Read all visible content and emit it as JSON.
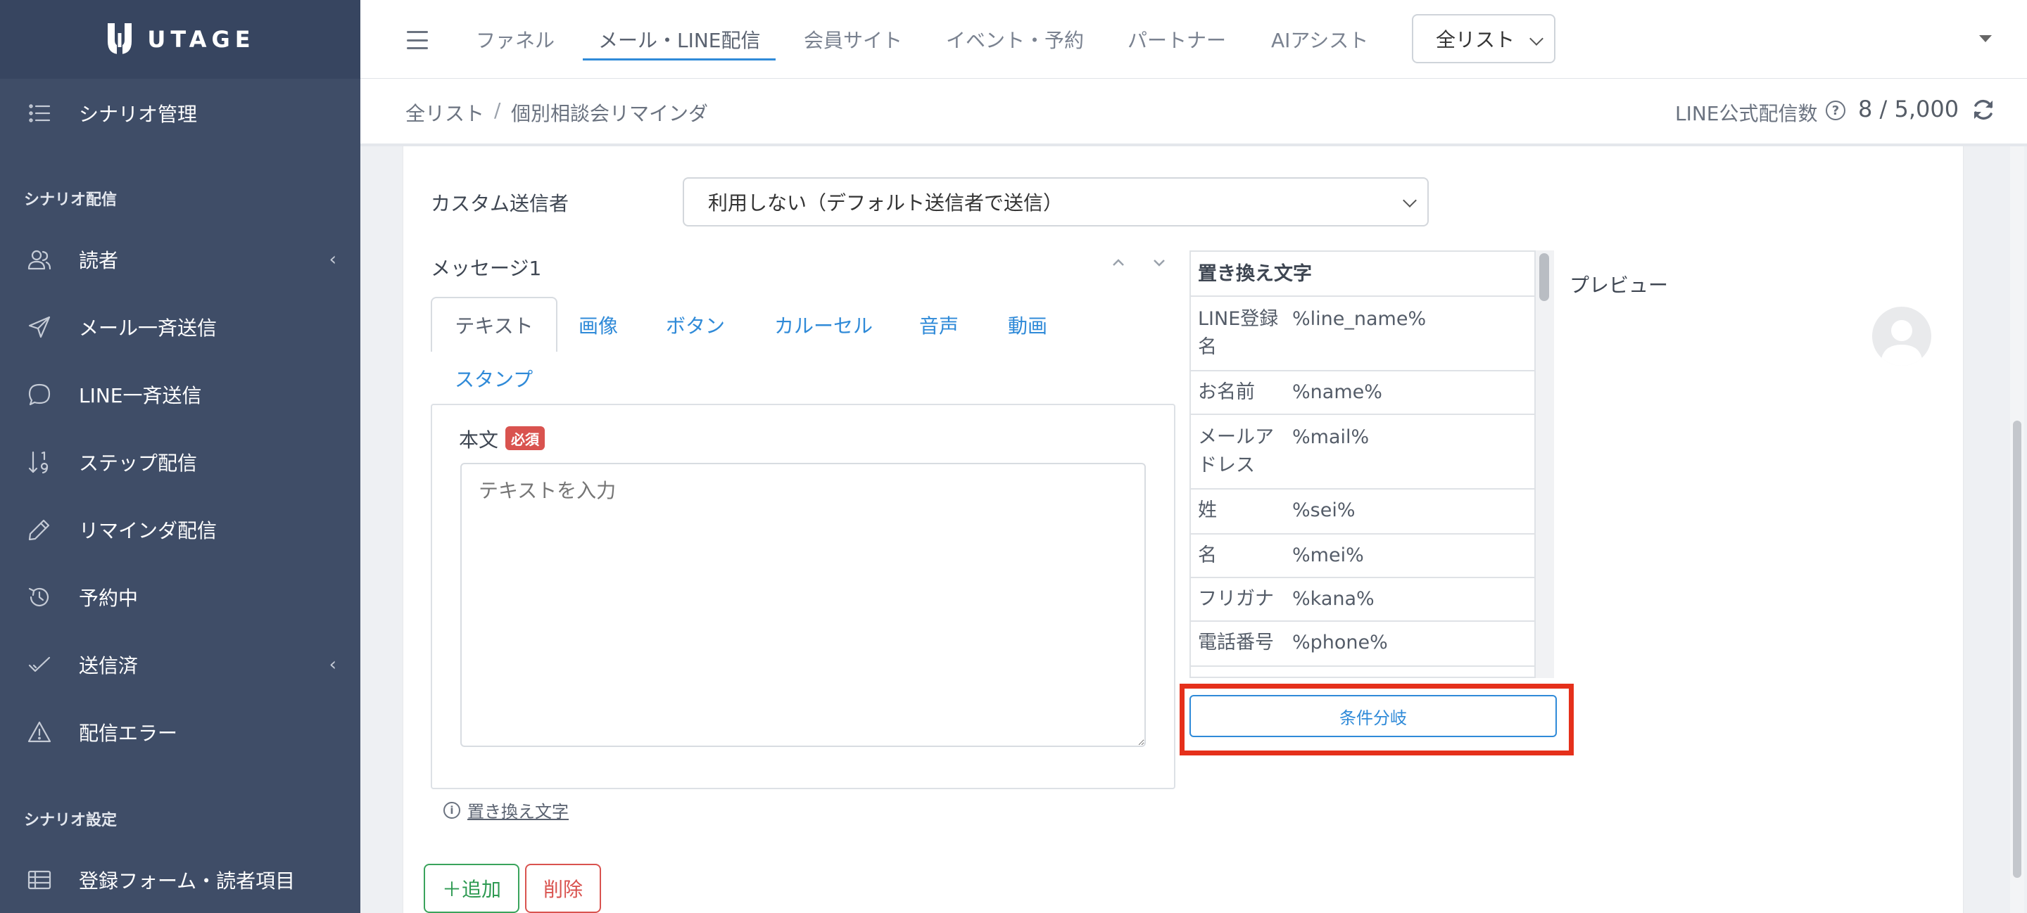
{
  "brand": {
    "name": "UTAGE"
  },
  "sidebar": {
    "items": [
      {
        "label": "シナリオ管理",
        "icon": "list-icon"
      },
      {
        "heading": "シナリオ配信"
      },
      {
        "label": "読者",
        "icon": "users-icon",
        "has_chevron": true
      },
      {
        "label": "メール一斉送信",
        "icon": "send-icon"
      },
      {
        "label": "LINE一斉送信",
        "icon": "chat-bubble-icon"
      },
      {
        "label": "ステップ配信",
        "icon": "sort-numeric-icon"
      },
      {
        "label": "リマインダ配信",
        "icon": "pencil-icon"
      },
      {
        "label": "予約中",
        "icon": "history-icon"
      },
      {
        "label": "送信済",
        "icon": "check-icon",
        "has_chevron": true
      },
      {
        "label": "配信エラー",
        "icon": "warning-icon"
      },
      {
        "heading": "シナリオ設定"
      },
      {
        "label": "登録フォーム・読者項目",
        "icon": "table-icon"
      }
    ],
    "chevron": "‹"
  },
  "topnav": {
    "tabs": [
      {
        "label": "ファネル"
      },
      {
        "label": "メール・LINE配信",
        "active": true
      },
      {
        "label": "会員サイト"
      },
      {
        "label": "イベント・予約"
      },
      {
        "label": "パートナー"
      },
      {
        "label": "AIアシスト"
      }
    ],
    "list_select": "全リスト"
  },
  "breadcrumb": {
    "items": [
      "全リスト",
      "個別相談会リマインダ"
    ],
    "separator": "/"
  },
  "quota": {
    "label": "LINE公式配信数",
    "value": "8 / 5,000"
  },
  "form": {
    "custom_sender_label": "カスタム送信者",
    "custom_sender_value": "利用しない（デフォルト送信者で送信）",
    "message_title": "メッセージ1",
    "message_tabs": [
      "テキスト",
      "画像",
      "ボタン",
      "カルーセル",
      "音声",
      "動画",
      "スタンプ"
    ],
    "active_tab": "テキスト",
    "body_label": "本文",
    "required_badge": "必須",
    "textarea_placeholder": "テキストを入力",
    "replacement_link": "置き換え文字",
    "add_button": "＋追加",
    "delete_button": "削除"
  },
  "replacement_table": {
    "header": "置き換え文字",
    "rows": [
      {
        "key": "LINE登録\n名",
        "value": "%line_name%"
      },
      {
        "key": "お名前",
        "value": "%name%"
      },
      {
        "key": "メールア\nドレス",
        "value": "%mail%"
      },
      {
        "key": "姓",
        "value": "%sei%"
      },
      {
        "key": "名",
        "value": "%mei%"
      },
      {
        "key": "フリガナ",
        "value": "%kana%"
      },
      {
        "key": "電話番号",
        "value": "%phone%"
      }
    ]
  },
  "condition_button": "条件分岐",
  "preview": {
    "label": "プレビュー"
  },
  "colors": {
    "sidebar_bg": "#3f4d67",
    "accent": "#2f8ad8",
    "danger": "#d9534f",
    "success": "#2e9a52",
    "highlight": "#e5301b"
  }
}
